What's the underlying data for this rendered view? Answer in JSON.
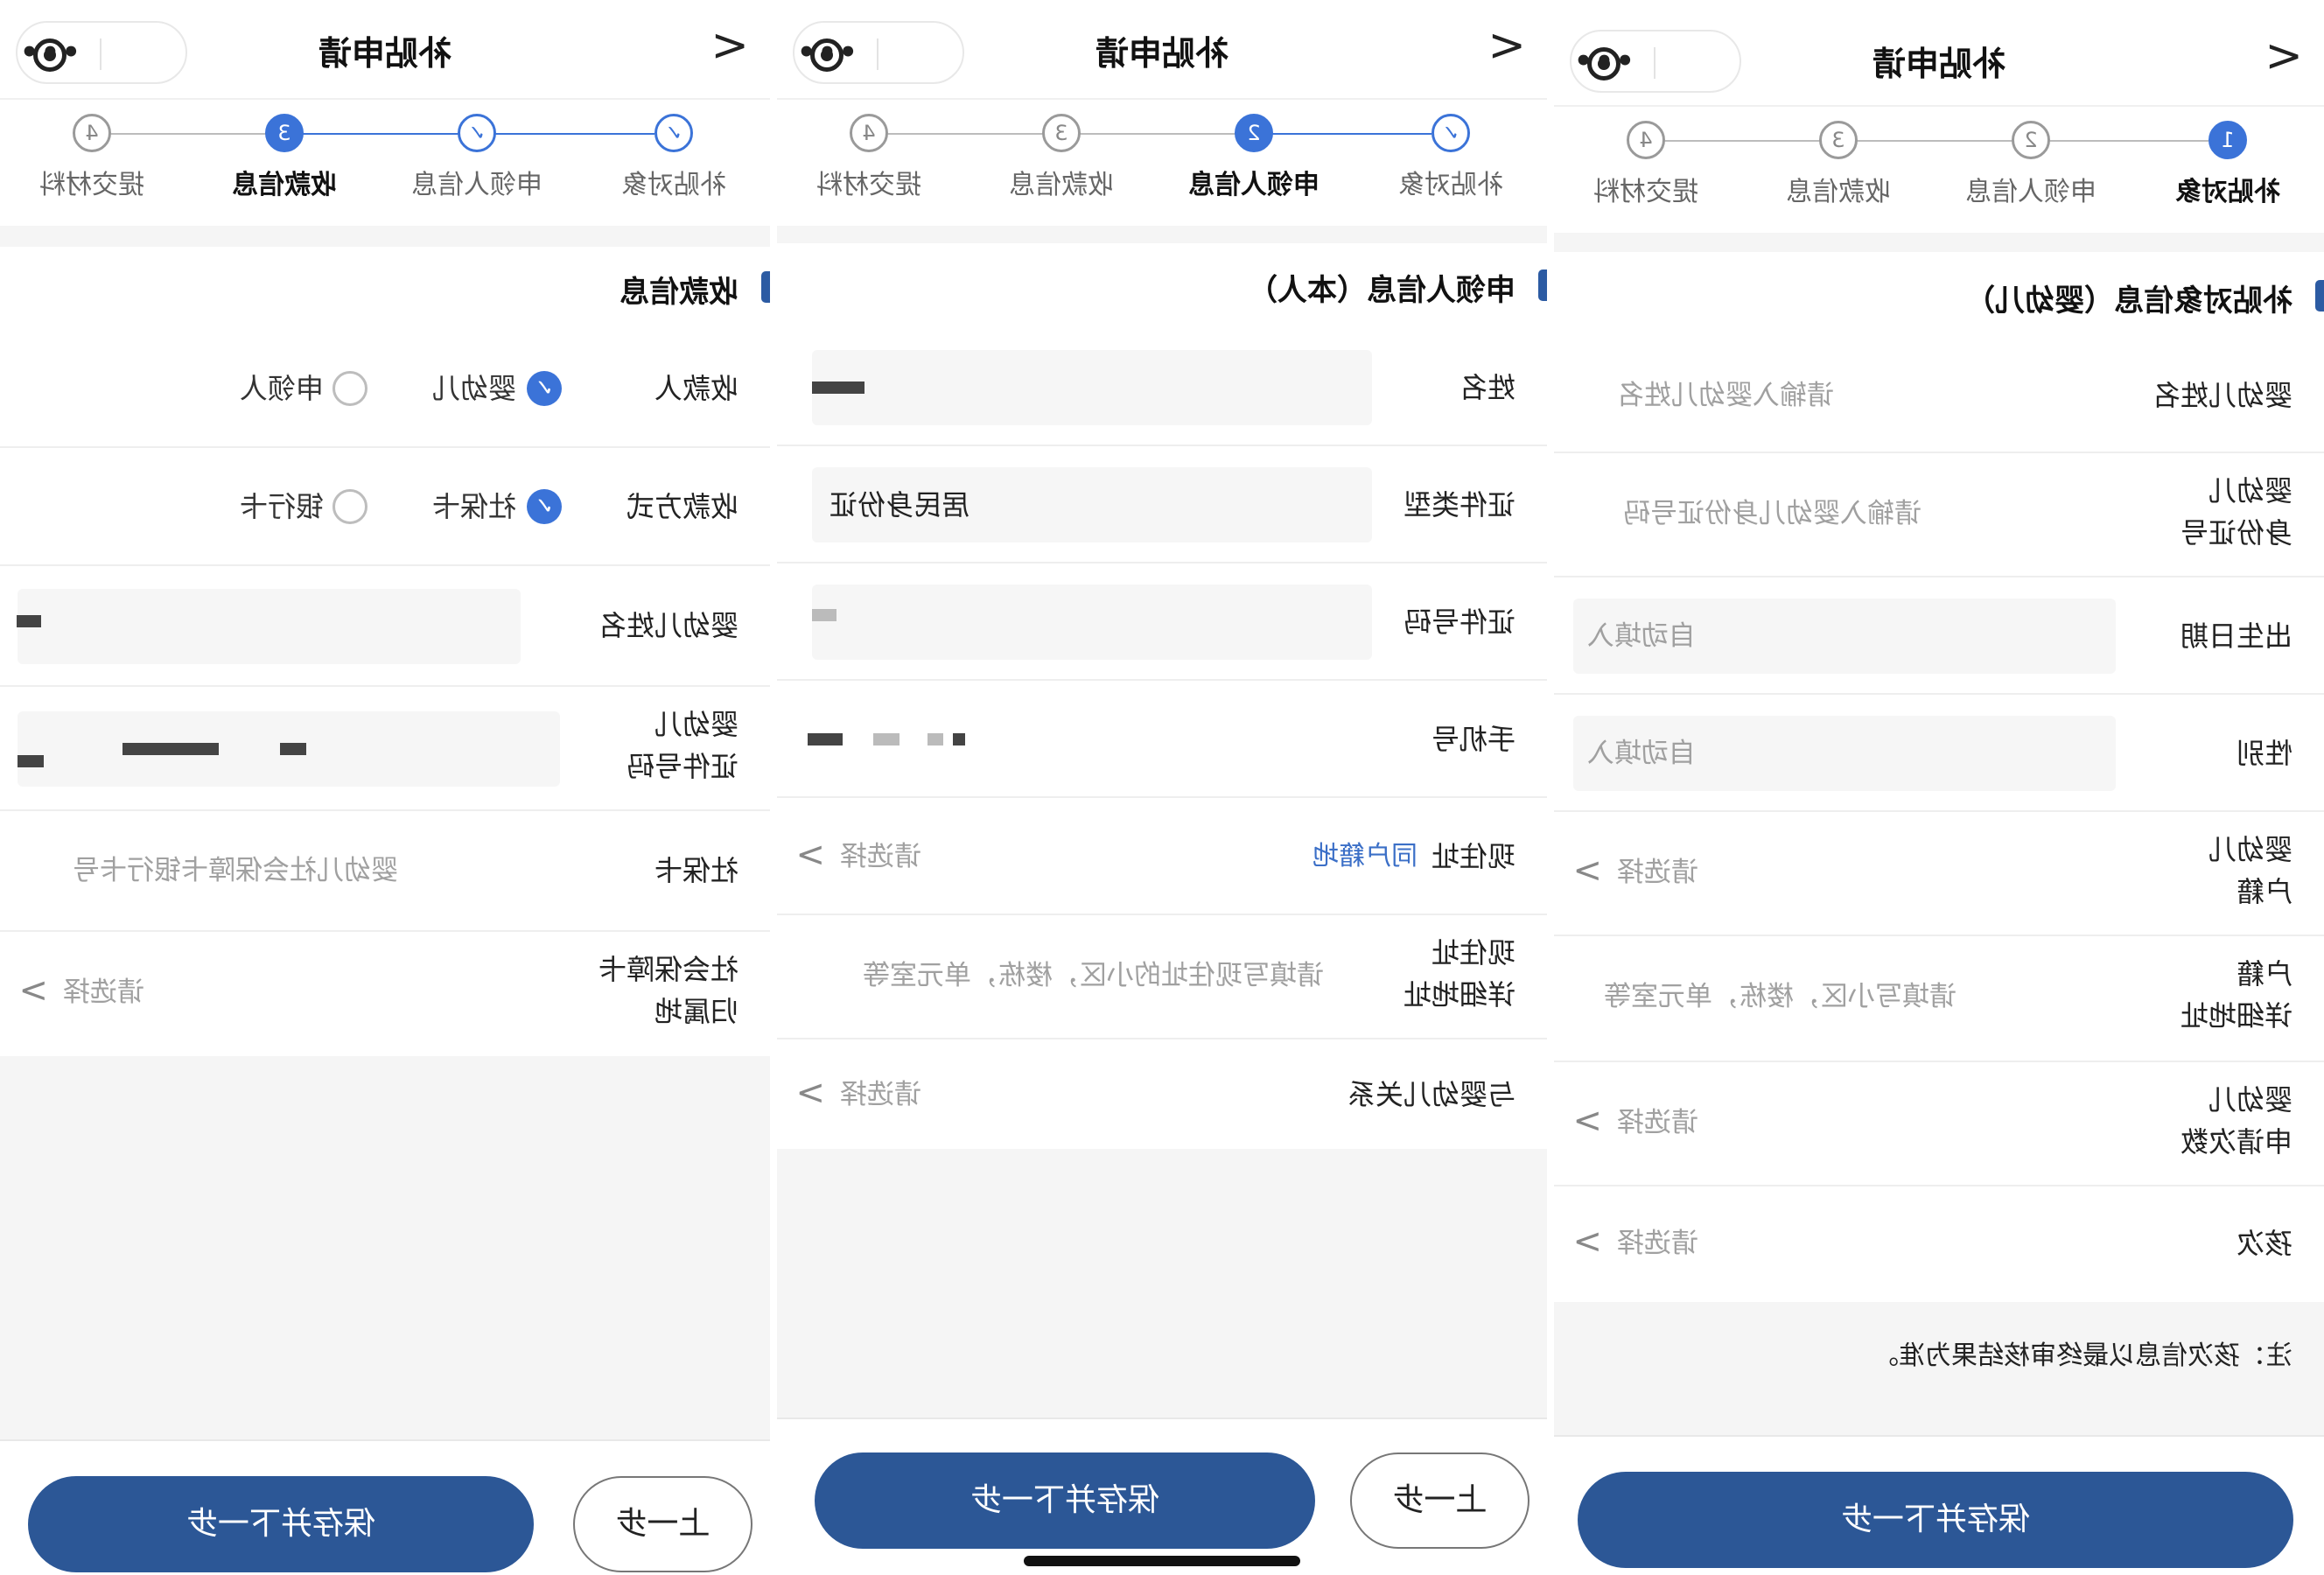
{
  "nav": {
    "title": "补贴申请",
    "chevron": ">"
  },
  "steps": [
    {
      "num": "1",
      "label": "补贴对象"
    },
    {
      "num": "2",
      "label": "申领人信息"
    },
    {
      "num": "3",
      "label": "收款信息"
    },
    {
      "num": "4",
      "label": "提交材料"
    }
  ],
  "panel_left": {
    "section_title": "收款信息",
    "payee_label": "收款人",
    "payee_opt1": "婴幼儿",
    "payee_opt2": "申领人",
    "method_label": "收款方式",
    "method_opt1": "社保卡",
    "method_opt2": "银行卡",
    "infant_name_label": "婴幼儿姓名",
    "infant_id_label_1": "婴幼儿",
    "infant_id_label_2": "证件号码",
    "ss_card_label": "社保卡",
    "ss_card_placeholder": "婴幼儿社会保障卡银行卡号",
    "ss_region_label_1": "社会保障卡",
    "ss_region_label_2": "归属地",
    "select_placeholder": "请选择",
    "btn_next": "保存并下一步",
    "btn_prev": "上一步"
  },
  "panel_middle": {
    "section_title": "申领人信息（本人）",
    "name_label": "姓名",
    "idtype_label": "证件类型",
    "idtype_value": "居民身份证",
    "idnum_label": "证件号码",
    "phone_label": "手机号",
    "addr_label": "现住址",
    "addr_link": "同户籍地",
    "addr_detail_label_1": "现住址",
    "addr_detail_label_2": "详细地址",
    "addr_detail_placeholder": "请填写现住址的小区，楼栋，单元室等",
    "relation_label": "与婴幼儿关系",
    "select_placeholder": "请选择",
    "btn_next": "保存并下一步",
    "btn_prev": "上一步"
  },
  "panel_right": {
    "section_title": "补贴对象信息（婴幼儿）",
    "name_label": "婴幼儿姓名",
    "name_placeholder": "请输入婴幼儿姓名",
    "id_label_1": "婴幼儿",
    "id_label_2": "身份证号",
    "id_placeholder": "请输入婴幼儿身份证号码",
    "birth_label": "出生日期",
    "auto_placeholder": "自动填入",
    "gender_label": "性别",
    "huji_label_1": "婴幼儿",
    "huji_label_2": "户籍",
    "huji_detail_label_1": "户籍",
    "huji_detail_label_2": "详细地址",
    "huji_detail_placeholder": "请填写小区，楼栋，单元室等",
    "count_label_1": "婴幼儿",
    "count_label_2": "申请次数",
    "order_label": "孩次",
    "select_placeholder": "请选择",
    "note": "注：孩次信息以最终审核结果为准。",
    "btn_next": "保存并下一步"
  },
  "colors": {
    "primary": "#2c5796",
    "accent": "#3b73d8",
    "section_bar": "#2c5ba3"
  }
}
